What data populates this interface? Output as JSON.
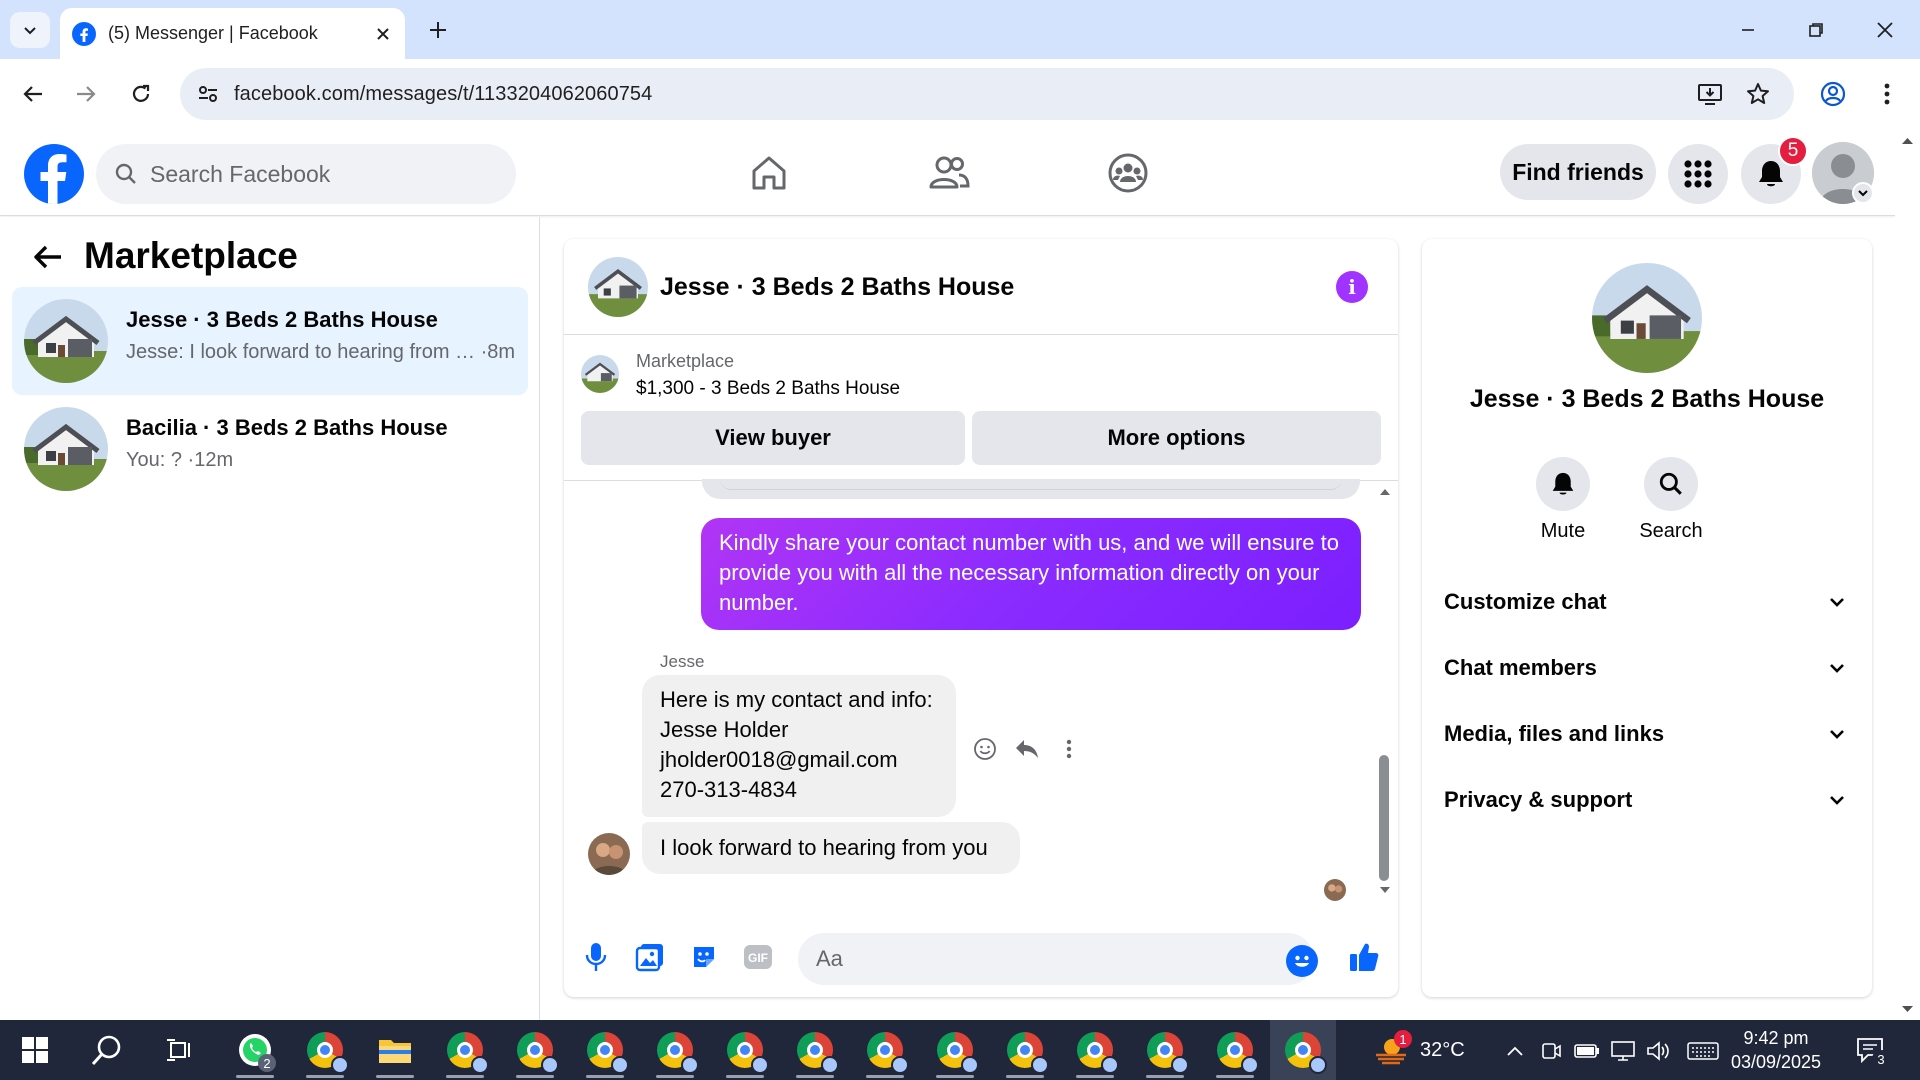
{
  "browser": {
    "tab_title": "(5) Messenger | Facebook",
    "url": "facebook.com/messages/t/1133204062060754"
  },
  "fb_header": {
    "search_placeholder": "Search Facebook",
    "find_friends_label": "Find friends",
    "notifications_count": "5",
    "nav_icons": [
      "home-icon",
      "friends-icon",
      "groups-icon"
    ],
    "brand_color": "#0866ff"
  },
  "sidebar": {
    "title": "Marketplace",
    "conversations": [
      {
        "name": "Jesse · 3 Beds 2 Baths House",
        "snippet": "Jesse: I look forward to hearing from … ·8m",
        "active": true
      },
      {
        "name": "Bacilia · 3 Beds 2 Baths House",
        "snippet": "You: ? ·12m",
        "active": false
      }
    ]
  },
  "chat": {
    "title": "Jesse · 3 Beds 2 Baths House",
    "marketplace_label": "Marketplace",
    "listing": "$1,300 - 3 Beds 2 Baths House",
    "view_buyer_label": "View buyer",
    "more_options_label": "More options",
    "messages": [
      {
        "from": "me",
        "text": "Kindly share your contact number with us, and we will ensure to provide you with all the necessary information directly on your number."
      },
      {
        "from": "Jesse",
        "lines": [
          "Here is my contact and info:",
          "Jesse Holder",
          "jholder0018@gmail.com",
          "270-313-4834"
        ]
      },
      {
        "from": "Jesse",
        "text": "I look forward to hearing from you"
      }
    ],
    "sender_label": "Jesse",
    "composer_placeholder": "Aa",
    "accent_color": "#a033ff"
  },
  "info_panel": {
    "title": "Jesse · 3 Beds 2 Baths House",
    "actions": [
      {
        "label": "Mute",
        "icon": "bell-icon"
      },
      {
        "label": "Search",
        "icon": "search-icon"
      }
    ],
    "sections": [
      "Customize chat",
      "Chat members",
      "Media, files and links",
      "Privacy & support"
    ]
  },
  "taskbar": {
    "whatsapp_badge": "2",
    "weather_badge": "1",
    "temperature": "32°C",
    "time": "9:42 pm",
    "date": "03/09/2025",
    "notification_count": "3"
  }
}
